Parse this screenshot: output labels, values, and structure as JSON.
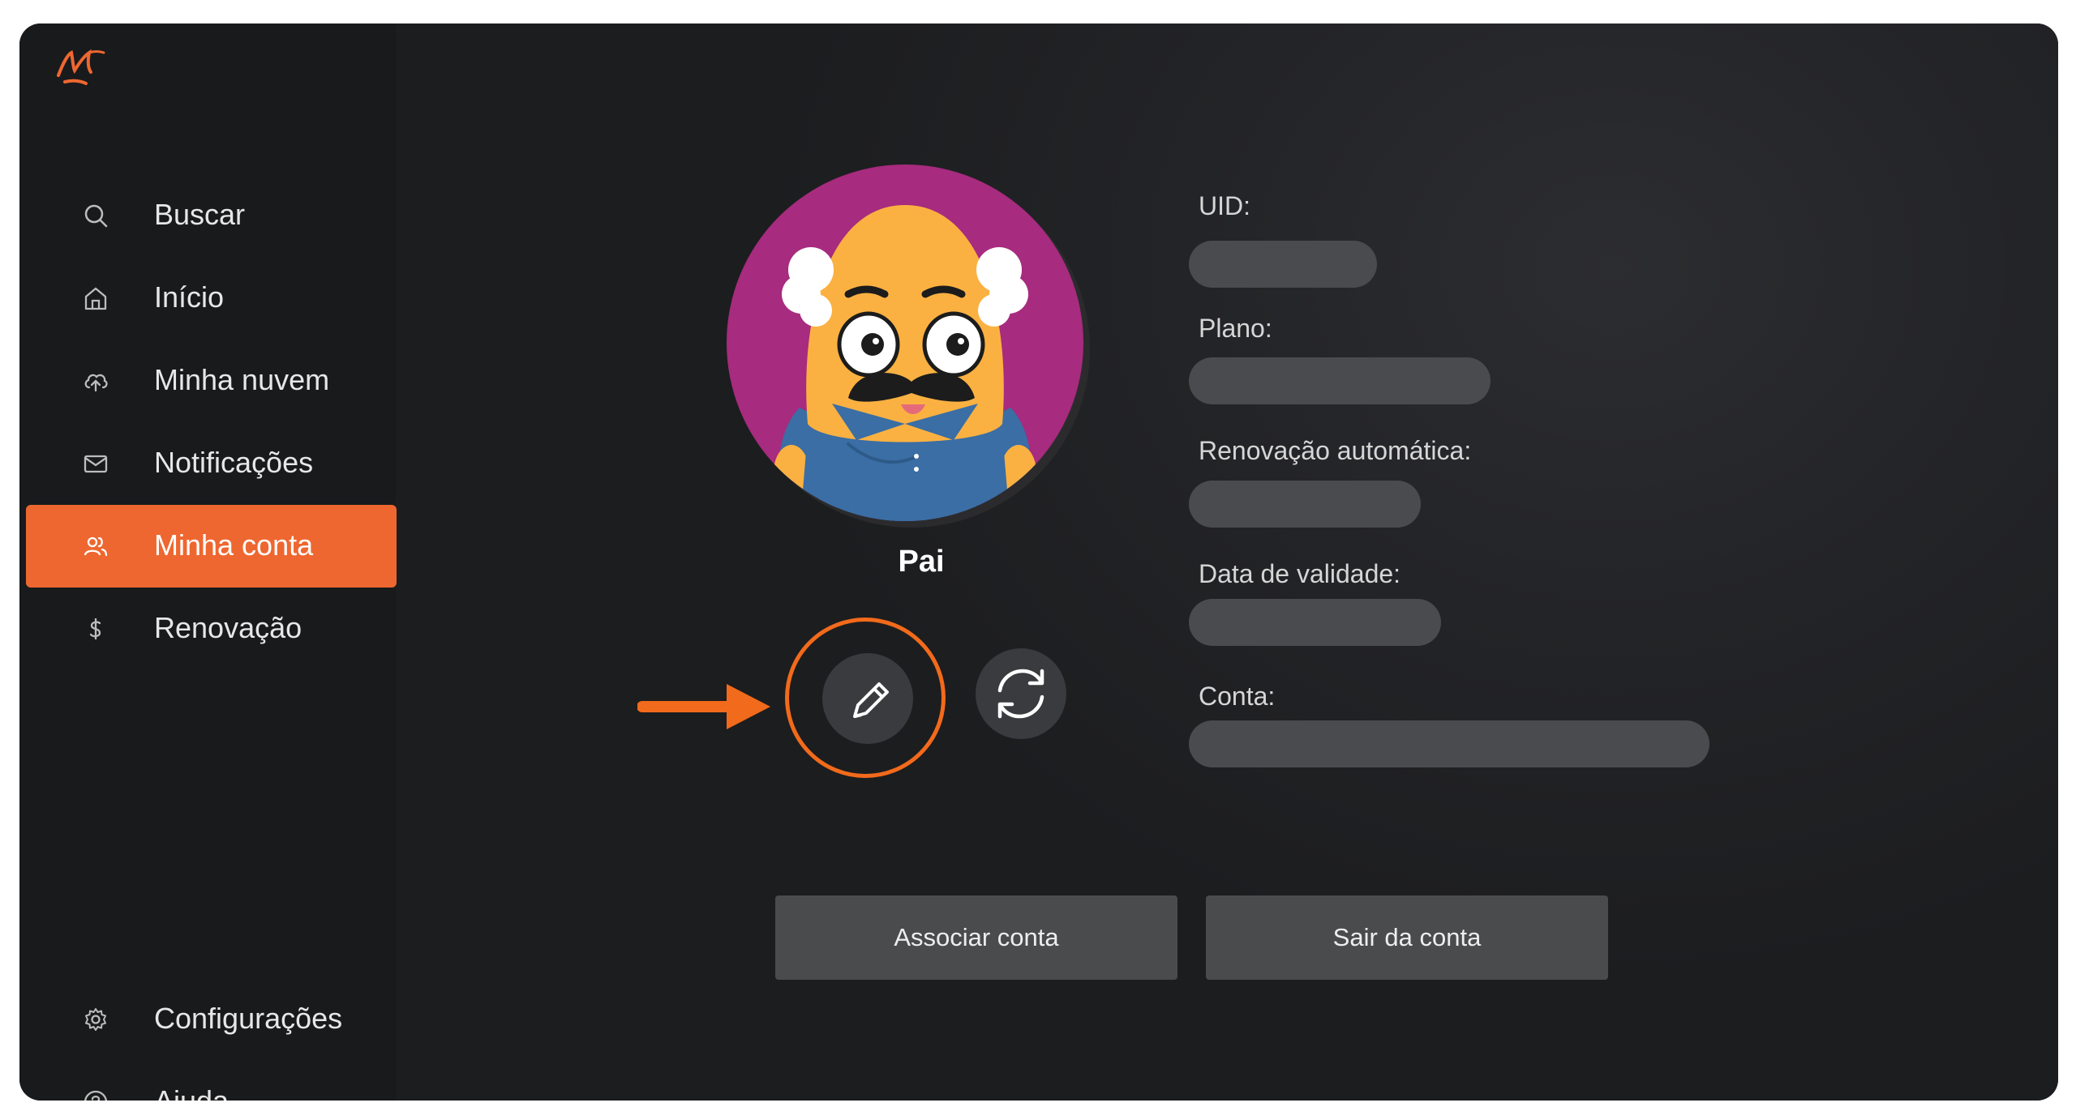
{
  "sidebar": {
    "logo_text": "M",
    "items": [
      {
        "label": "Buscar",
        "icon": "search-icon"
      },
      {
        "label": "Início",
        "icon": "home-icon"
      },
      {
        "label": "Minha nuvem",
        "icon": "cloud-upload-icon"
      },
      {
        "label": "Notificações",
        "icon": "mail-icon"
      },
      {
        "label": "Minha conta",
        "icon": "users-icon",
        "active": true
      },
      {
        "label": "Renovação",
        "icon": "dollar-icon"
      }
    ],
    "bottom_items": [
      {
        "label": "Configurações",
        "icon": "gear-icon"
      },
      {
        "label": "Ajuda",
        "icon": "help-icon"
      }
    ]
  },
  "profile": {
    "name": "Pai",
    "edit_icon": "pencil-icon",
    "switch_icon": "refresh-icon"
  },
  "fields": [
    {
      "label": "UID:",
      "value": ""
    },
    {
      "label": "Plano:",
      "value": ""
    },
    {
      "label": "Renovação automática:",
      "value": ""
    },
    {
      "label": "Data de validade:",
      "value": ""
    },
    {
      "label": "Conta:",
      "value": ""
    }
  ],
  "actions": {
    "associate_label": "Associar conta",
    "logout_label": "Sair da conta"
  },
  "colors": {
    "accent": "#ee6730",
    "highlight": "#f26a1b",
    "background": "#1a1b1d",
    "pill": "#4a4b4e"
  }
}
